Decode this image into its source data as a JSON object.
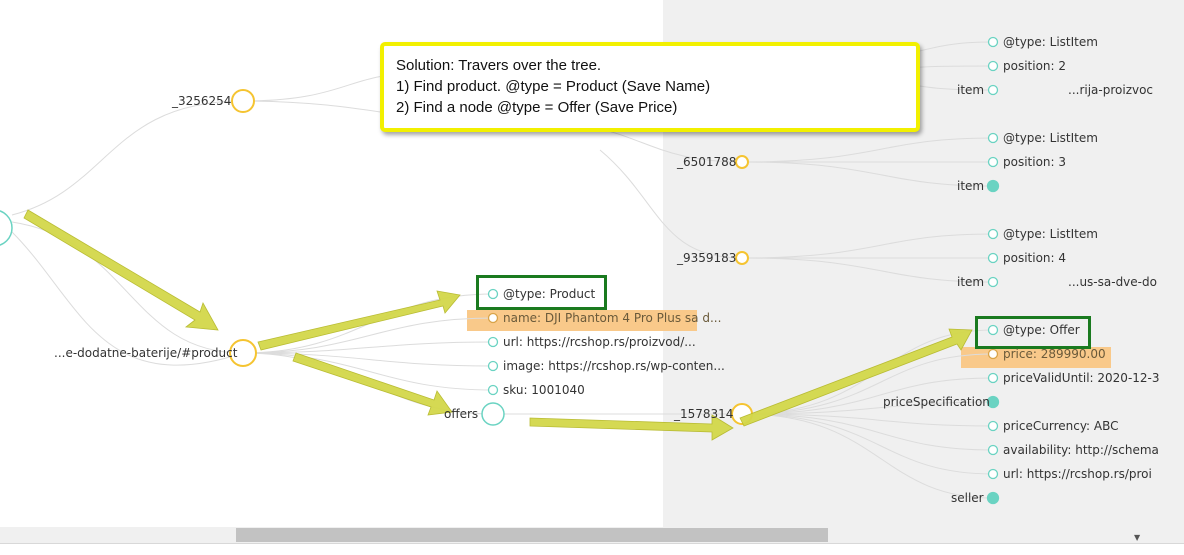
{
  "callout": {
    "line1": "Solution: Travers over the tree.",
    "line2": "1) Find product. @type = Product (Save Name)",
    "line3": "2) Find a node @type = Offer (Save Price)"
  },
  "tree": {
    "left_nodes": {
      "node_3256254": "_3256254",
      "product_node": "...e-dodatne-baterije/#product",
      "offers_label": "offers"
    },
    "product_fields": {
      "type": "@type: Product",
      "name": "name: DJI Phantom 4 Pro Plus sa d...",
      "url": "url: https://rcshop.rs/proizvod/...",
      "image": "image: https://rcshop.rs/wp-conten...",
      "sku": "sku: 1001040"
    },
    "mid_nodes": {
      "node_6501788": "_6501788",
      "node_9359183": "_9359183",
      "node_1578314": "_1578314"
    },
    "list_items": {
      "g1_type": "@type: ListItem",
      "g1_position": "position: 2",
      "g1_item": "item",
      "g1_item_value": "...rija-proizvoc",
      "g2_type": "@type: ListItem",
      "g2_position": "position: 3",
      "g2_item": "item",
      "g3_type": "@type: ListItem",
      "g3_position": "position: 4",
      "g3_item": "item",
      "g3_item_value": "...us-sa-dve-do"
    },
    "offer_fields": {
      "type": "@type: Offer",
      "price": "price: 289990.00",
      "price_valid": "priceValidUntil: 2020-12-3",
      "price_spec": "priceSpecification",
      "currency": "priceCurrency: ABC",
      "availability": "availability: http://schema",
      "url": "url: https://rcshop.rs/proi",
      "seller": "seller"
    }
  },
  "colors": {
    "node_yellow": "#f5c431",
    "node_teal": "#6ad3c2",
    "arrow": "#d3d84a",
    "highlight_orange": "#f9c98a",
    "box_green": "#1a7a1f"
  }
}
